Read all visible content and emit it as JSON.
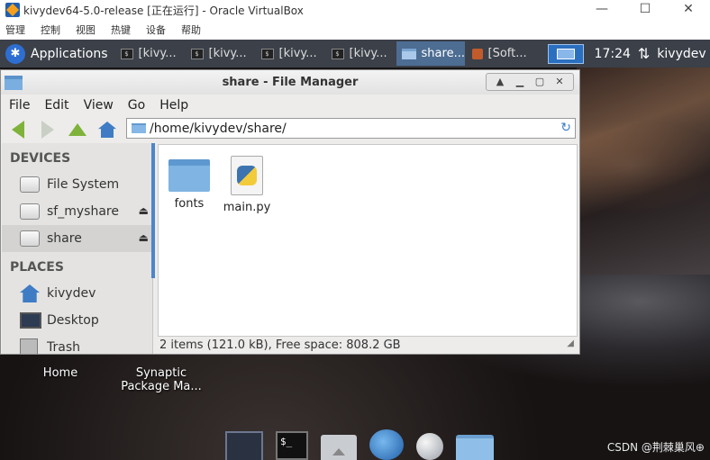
{
  "vbox": {
    "title": "kivydev64-5.0-release [正在运行] - Oracle VirtualBox",
    "menu": [
      "管理",
      "控制",
      "视图",
      "热键",
      "设备",
      "帮助"
    ],
    "win_minimize": "—",
    "win_maximize": "☐",
    "win_close": "✕"
  },
  "panel": {
    "applications_label": "Applications",
    "tasks": [
      {
        "label": "[kivy...",
        "icon": "terminal-icon"
      },
      {
        "label": "[kivy...",
        "icon": "terminal-icon"
      },
      {
        "label": "[kivy...",
        "icon": "terminal-icon"
      },
      {
        "label": "[kivy...",
        "icon": "terminal-icon"
      },
      {
        "label": "share...",
        "icon": "folder-icon"
      },
      {
        "label": "[Soft...",
        "icon": "software-icon"
      }
    ],
    "clock": "17:24",
    "network_glyph": "⇅",
    "user": "kivydev"
  },
  "desktop": {
    "icons": [
      {
        "label": "Home"
      },
      {
        "label": "Synaptic\nPackage Ma..."
      }
    ],
    "terminal_prompt": "$_"
  },
  "filemanager": {
    "title": "share - File Manager",
    "menu": [
      "File",
      "Edit",
      "View",
      "Go",
      "Help"
    ],
    "location": "/home/kivydev/share/",
    "sidebar": {
      "devices_heading": "DEVICES",
      "devices": [
        {
          "label": "File System",
          "eject": ""
        },
        {
          "label": "sf_myshare",
          "eject": "⏏"
        },
        {
          "label": "share",
          "eject": "⏏"
        }
      ],
      "places_heading": "PLACES",
      "places": [
        {
          "label": "kivydev"
        },
        {
          "label": "Desktop"
        },
        {
          "label": "Trash"
        }
      ]
    },
    "files": [
      {
        "name": "fonts",
        "type": "folder"
      },
      {
        "name": "main.py",
        "type": "python"
      }
    ],
    "status": "2 items (121.0 kB), Free space: 808.2 GB"
  },
  "watermark": "CSDN @荆棘巢风⊕",
  "colors": {
    "panel": "#3b4049",
    "active_task": "#4d6d93",
    "accent": "#4e85c8"
  }
}
